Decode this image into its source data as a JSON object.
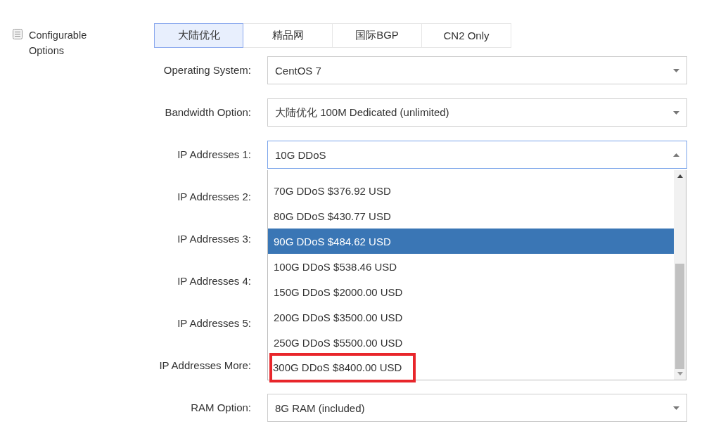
{
  "section": {
    "title": "Configurable Options"
  },
  "tabs": [
    {
      "label": "大陆优化",
      "selected": true
    },
    {
      "label": "精品网",
      "selected": false
    },
    {
      "label": "国际BGP",
      "selected": false
    },
    {
      "label": "CN2 Only",
      "selected": false
    }
  ],
  "options": [
    {
      "label": "Operating System:",
      "value": "CentOS 7",
      "open": false
    },
    {
      "label": "Bandwidth Option:",
      "value": "大陆优化 100M Dedicated (unlimited)",
      "open": false
    },
    {
      "label": "IP Addresses 1:",
      "value": "10G DDoS",
      "open": true
    },
    {
      "label": "IP Addresses 2:"
    },
    {
      "label": "IP Addresses 3:"
    },
    {
      "label": "IP Addresses 4:"
    },
    {
      "label": "IP Addresses 5:"
    },
    {
      "label": "IP Addresses More:"
    },
    {
      "label": "RAM Option:",
      "value": "8G RAM (included)",
      "open": false
    }
  ],
  "dropdown": {
    "items": [
      {
        "label": "70G DDoS $376.92 USD",
        "selected": false,
        "highlighted": false
      },
      {
        "label": "80G DDoS $430.77 USD",
        "selected": false,
        "highlighted": false
      },
      {
        "label": "90G DDoS $484.62 USD",
        "selected": true,
        "highlighted": false
      },
      {
        "label": "100G DDoS $538.46 USD",
        "selected": false,
        "highlighted": false
      },
      {
        "label": "150G DDoS $2000.00 USD",
        "selected": false,
        "highlighted": false
      },
      {
        "label": "200G DDoS $3500.00 USD",
        "selected": false,
        "highlighted": false
      },
      {
        "label": "250G DDoS $5500.00 USD",
        "selected": false,
        "highlighted": false
      },
      {
        "label": "300G DDoS $8400.00 USD",
        "selected": false,
        "highlighted": true
      }
    ]
  }
}
